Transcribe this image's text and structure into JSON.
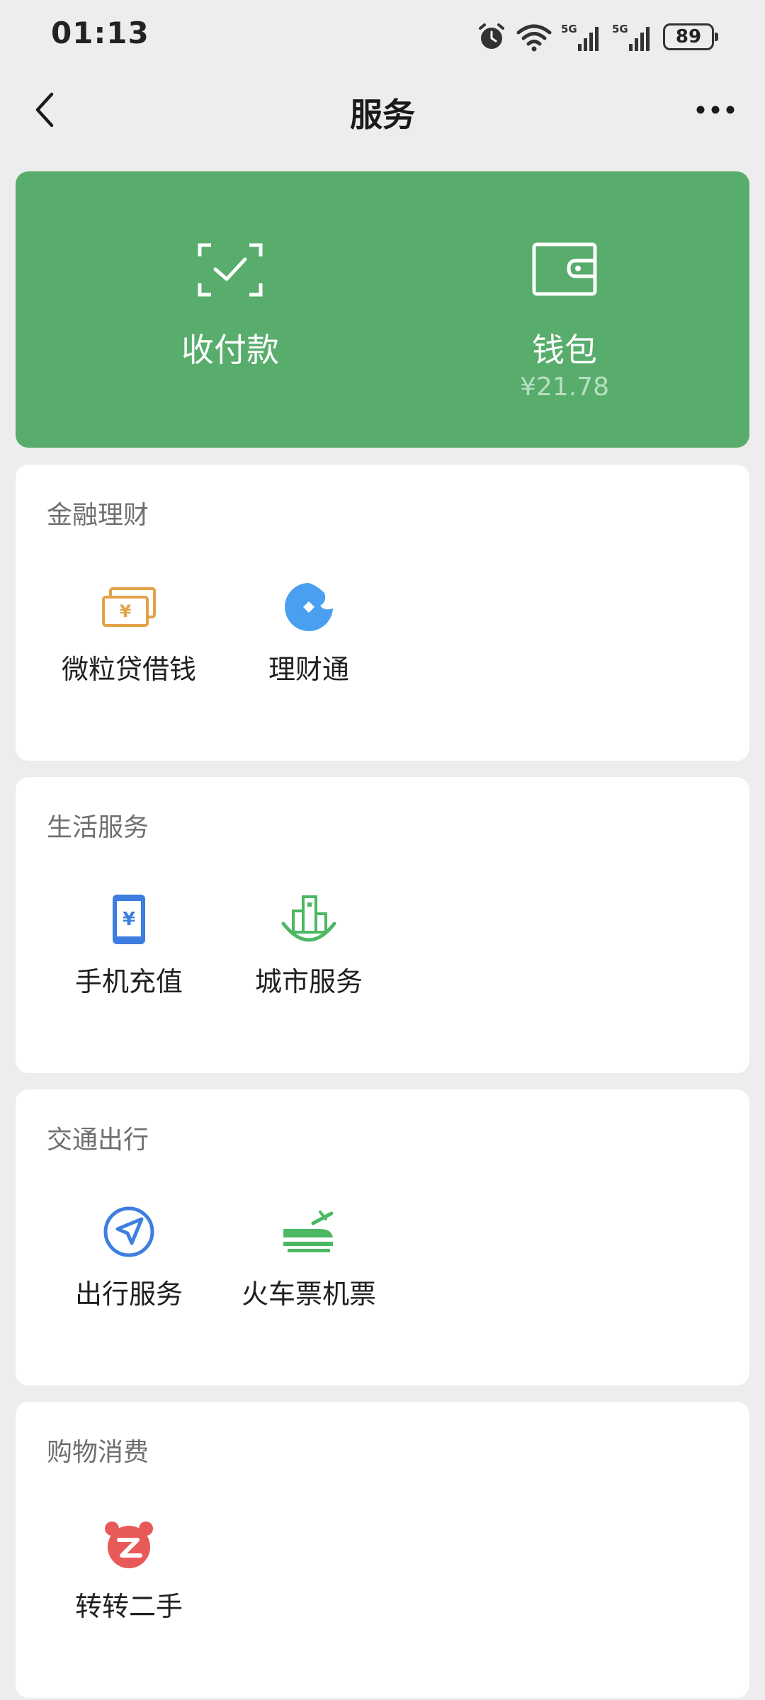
{
  "status_bar": {
    "time": "01:13",
    "battery": "89",
    "signal_label": "5G",
    "icons": [
      "alarm-icon",
      "wifi-icon",
      "signal-5g-icon",
      "signal-5g-icon",
      "battery-icon"
    ]
  },
  "nav": {
    "title": "服务",
    "back_icon": "chevron-left-icon",
    "more_icon": "more-dots-icon"
  },
  "wallet_card": {
    "background": "#58ac6c",
    "items": [
      {
        "label": "收付款",
        "icon": "scan-check-icon"
      },
      {
        "label": "钱包",
        "icon": "wallet-icon",
        "balance": "¥21.78"
      }
    ]
  },
  "sections": [
    {
      "title": "金融理财",
      "items": [
        {
          "label": "微粒贷借钱",
          "icon": "money-bill-icon",
          "color": "#e3a24a"
        },
        {
          "label": "理财通",
          "icon": "licaitong-icon",
          "color": "#4a9ff0"
        }
      ]
    },
    {
      "title": "生活服务",
      "items": [
        {
          "label": "手机充值",
          "icon": "phone-recharge-icon",
          "color": "#3d7ee0"
        },
        {
          "label": "城市服务",
          "icon": "city-buildings-icon",
          "color": "#4cb862"
        }
      ]
    },
    {
      "title": "交通出行",
      "items": [
        {
          "label": "出行服务",
          "icon": "navigation-arrow-icon",
          "color": "#3d7ee0"
        },
        {
          "label": "火车票机票",
          "icon": "train-plane-icon",
          "color": "#4cb862"
        }
      ]
    },
    {
      "title": "购物消费",
      "items": [
        {
          "label": "转转二手",
          "icon": "zhuanzhuan-icon",
          "color": "#e85a58"
        }
      ]
    }
  ]
}
